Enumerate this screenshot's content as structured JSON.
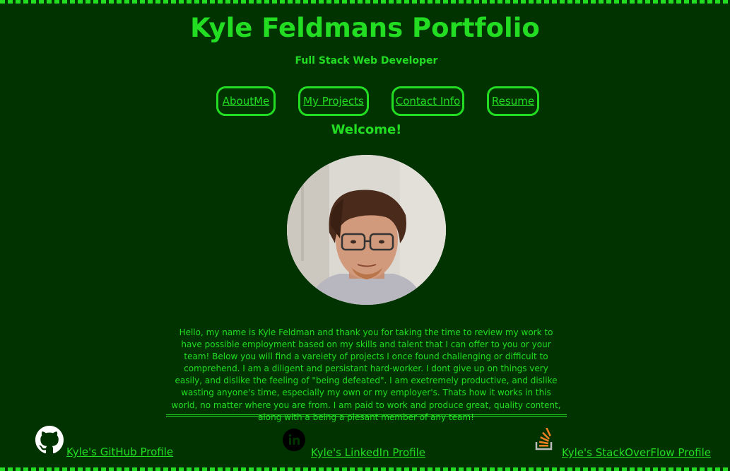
{
  "header": {
    "title": "Kyle Feldmans Portfolio",
    "subtitle": "Full Stack Web Developer"
  },
  "nav": {
    "items": [
      {
        "label": "AboutMe"
      },
      {
        "label": "My Projects"
      },
      {
        "label": "Contact Info"
      },
      {
        "label": "Resume"
      }
    ]
  },
  "main": {
    "welcome": "Welcome!",
    "bio": "Hello, my name is Kyle Feldman and thank you for taking the time to review my work to have possible employment based on my skills and talent that I can offer to you or your team! Below you will find a vareiety of projects I once found challenging or difficult to comprehend. I am a diligent and persistant hard-worker. I dont give up on things very easily, and dislike the feeling of \"being defeated\". I am exetremely productive, and dislike wasting anyone's time, especially my own or my employer's. Thats how it works in this world, no matter where you are from. I am paid to work and produce great, quality content, along with a being a plesant member of any team!"
  },
  "footer": {
    "github": {
      "label": "Kyle's GitHub Profile",
      "icon": "github-icon"
    },
    "linkedin": {
      "label": "Kyle's LinkedIn Profile",
      "icon": "linkedin-icon"
    },
    "stackoverflow": {
      "label": "Kyle's StackOverFlow Profile",
      "icon": "stackoverflow-icon"
    }
  },
  "colors": {
    "background": "#003300",
    "accent": "#22dd22"
  }
}
